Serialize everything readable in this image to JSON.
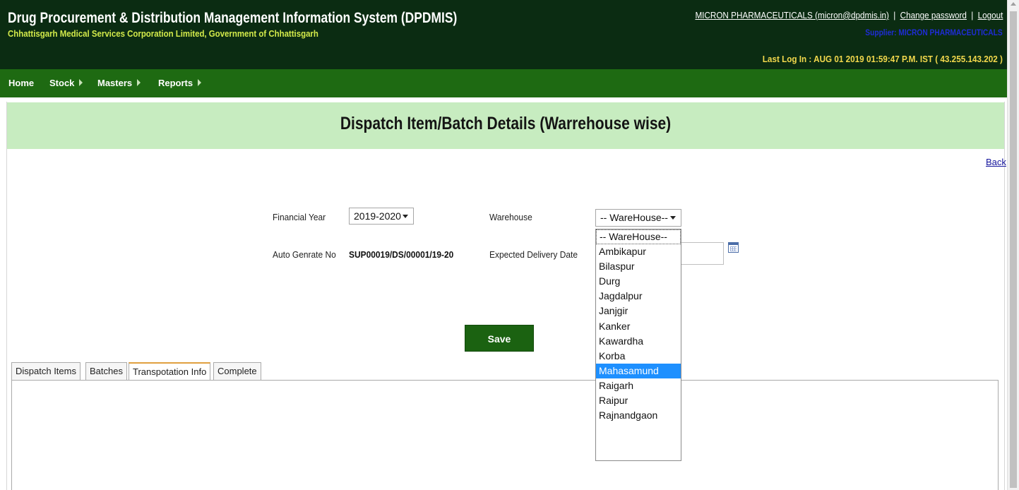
{
  "header": {
    "system_title": "Drug Procurement & Distribution Management Information System (DPDMIS)",
    "subtitle": "Chhattisgarh Medical Services Corporation Limited, Government of Chhattisgarh",
    "user_link": "MICRON PHARMACEUTICALS (micron@dpdmis.in)",
    "separator": "|",
    "change_password": "Change password",
    "logout": "Logout",
    "supplier_label": "Supplier: MICRON PHARMACEUTICALS",
    "last_login": "Last Log In : AUG 01 2019 01:59:47 P.M. IST ( 43.255.143.202 )"
  },
  "nav": {
    "items": [
      {
        "label": "Home",
        "has_arrow": false
      },
      {
        "label": "Stock",
        "has_arrow": true
      },
      {
        "label": "Masters",
        "has_arrow": true
      },
      {
        "label": "Reports",
        "has_arrow": true
      }
    ]
  },
  "page": {
    "title": "Dispatch Item/Batch Details (Warrehouse wise)",
    "back": "Back"
  },
  "form": {
    "financial_year_label": "Financial Year",
    "financial_year_value": "2019-2020",
    "warehouse_label": "Warehouse",
    "warehouse_value": "-- WareHouse--",
    "auto_no_label": "Auto Genrate No",
    "auto_no_value": "SUP00019/DS/00001/19-20",
    "expected_date_label": "Expected Delivery Date",
    "save_label": "Save"
  },
  "dropdown": {
    "options": [
      "-- WareHouse--",
      "Ambikapur",
      "Bilaspur",
      "Durg",
      "Jagdalpur",
      "Janjgir",
      "Kanker",
      "Kawardha",
      "Korba",
      "Mahasamund",
      "Raigarh",
      "Raipur",
      "Rajnandgaon"
    ],
    "highlighted": "Mahasamund"
  },
  "tabs": [
    {
      "label": "Dispatch Items",
      "active": false
    },
    {
      "label": "Batches",
      "active": false
    },
    {
      "label": "Transpotation Info",
      "active": true
    },
    {
      "label": "Complete",
      "active": false
    }
  ],
  "colors": {
    "header_bg": "#0b2c12",
    "nav_bg": "#1e6a12",
    "banner_bg": "#c7ecc0",
    "subtitle": "#d3ea4a",
    "last_login": "#f2d84c",
    "highlight": "#1e90ff",
    "save_bg": "#1b6211"
  }
}
